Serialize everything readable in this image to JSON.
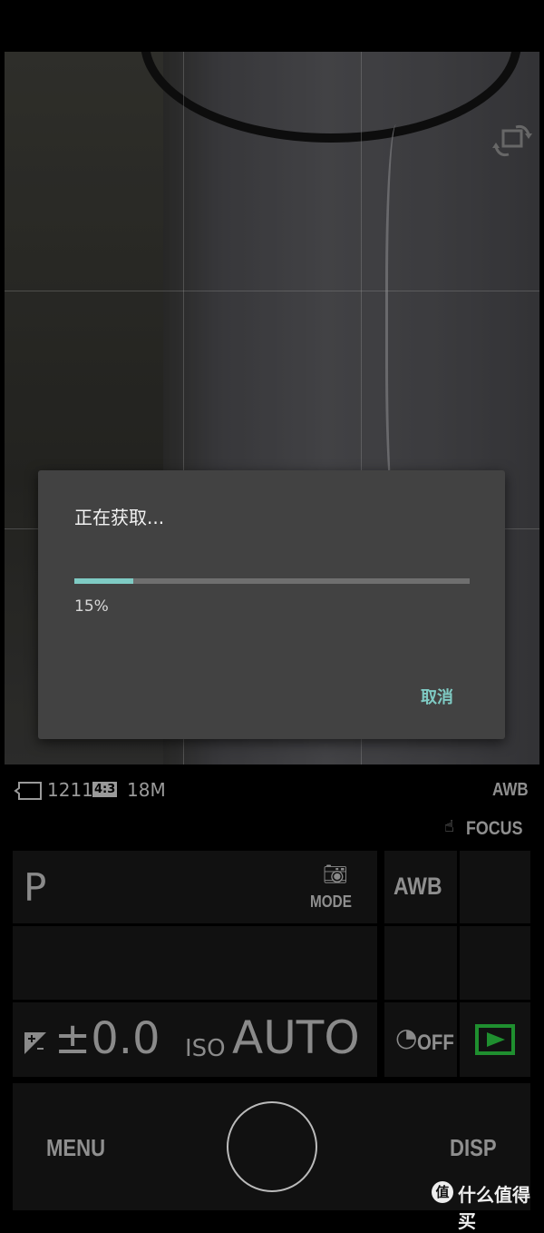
{
  "dialog": {
    "title": "正在获取...",
    "progress_percent": 15,
    "progress_label": "15%",
    "cancel_label": "取消",
    "accent": "#7fcbc4"
  },
  "status": {
    "shots_remaining": "1211",
    "aspect": "4:3",
    "size": "18M",
    "wb": "AWB",
    "focus": "FOCUS"
  },
  "controls": {
    "mode_value": "P",
    "mode_label": "MODE",
    "wb_label": "AWB",
    "ev_value": "±0.0",
    "iso_label": "ISO",
    "iso_value": "AUTO",
    "timer_label": "OFF",
    "menu_label": "MENU",
    "disp_label": "DISP",
    "playback_color": "#1f8f2f"
  },
  "watermark": {
    "text": "什么值得买",
    "logo": "值"
  }
}
